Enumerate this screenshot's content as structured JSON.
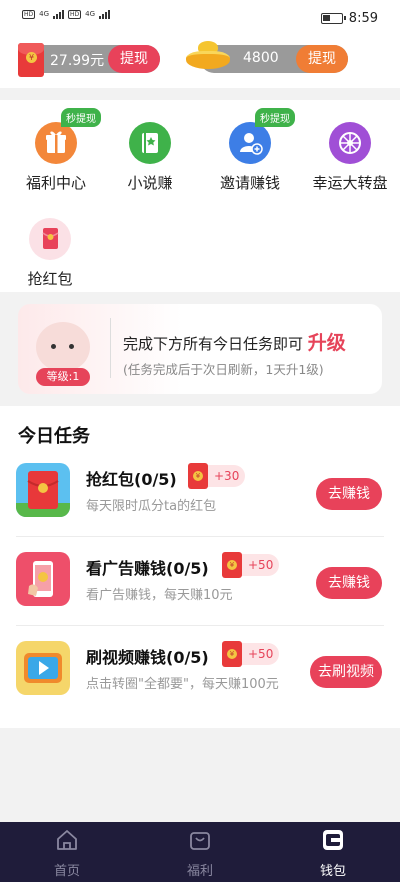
{
  "status_bar": {
    "time": "8:59",
    "net1": "HD",
    "net2": "4G"
  },
  "balance": {
    "cash_value": "27.99元",
    "cash_button": "提现",
    "coin_value": "4800",
    "coin_button": "提现"
  },
  "shortcuts": [
    {
      "label": "福利中心",
      "badge": "秒提现",
      "icon": "gift-icon",
      "color": "#f3873a"
    },
    {
      "label": "小说赚",
      "badge": "",
      "icon": "book-icon",
      "color": "#3fb24a"
    },
    {
      "label": "邀请赚钱",
      "badge": "秒提现",
      "icon": "invite-user-icon",
      "color": "#3d7ee6"
    },
    {
      "label": "幸运大转盘",
      "badge": "",
      "icon": "wheel-icon",
      "color": "#a04fd6"
    },
    {
      "label": "抢红包",
      "badge": "",
      "icon": "red-envelope-icon",
      "color": "#e8425a"
    }
  ],
  "level": {
    "main_text": "完成下方所有今日任务即可",
    "highlight": "升级",
    "sub_text": "(任务完成后于次日刷新，1天升1级)",
    "level_tag": "等级:1"
  },
  "tasks": {
    "title": "今日任务",
    "items": [
      {
        "title": "抢红包(0/5)",
        "reward": "+30",
        "desc": "每天限时瓜分ta的红包",
        "button": "去赚钱"
      },
      {
        "title": "看广告赚钱(0/5)",
        "reward": "+50",
        "desc": "看广告赚钱，每天赚10元",
        "button": "去赚钱"
      },
      {
        "title": "刷视频赚钱(0/5)",
        "reward": "+50",
        "desc": "点击转圈\"全都要\"，每天赚100元",
        "button": "去刷视频"
      }
    ]
  },
  "bottom_nav": [
    {
      "label": "首页",
      "active": false
    },
    {
      "label": "福利",
      "active": false
    },
    {
      "label": "钱包",
      "active": true
    }
  ],
  "colors": {
    "accent_red": "#e8425a",
    "accent_orange": "#f07d35",
    "nav_bg": "#1f1c3a",
    "badge_green": "#3fb24a"
  }
}
